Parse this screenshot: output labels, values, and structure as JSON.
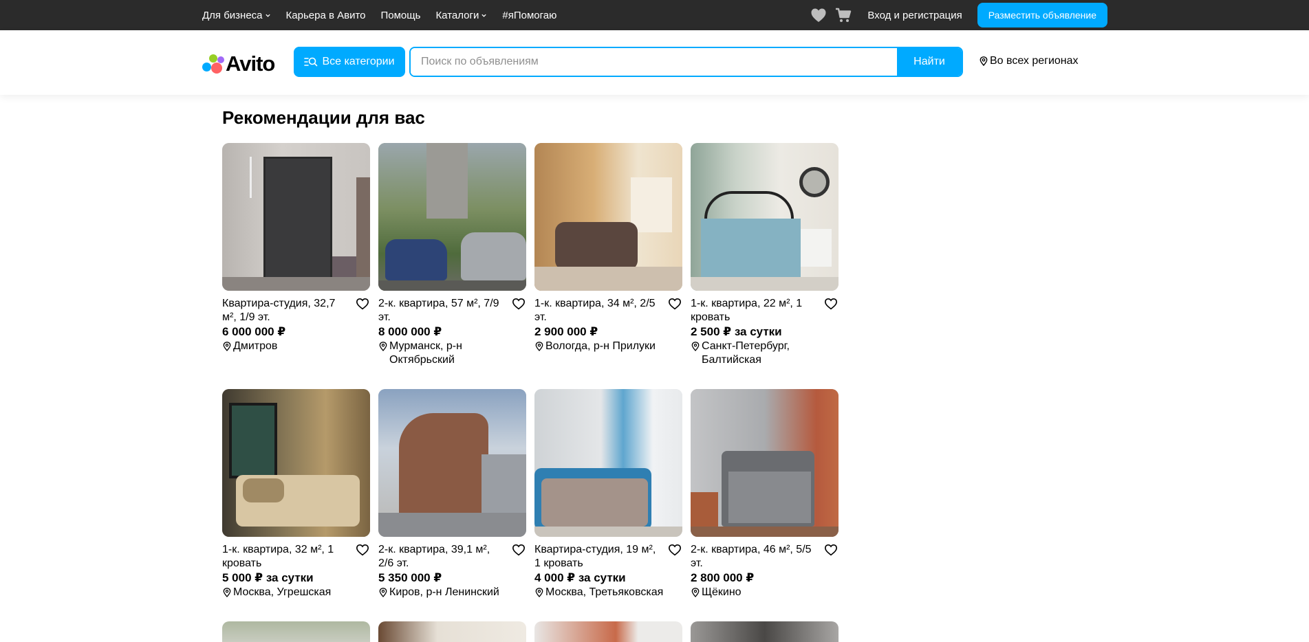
{
  "topbar": {
    "nav": [
      {
        "label": "Для бизнеса",
        "dropdown": true
      },
      {
        "label": "Карьера в Авито",
        "dropdown": false
      },
      {
        "label": "Помощь",
        "dropdown": false
      },
      {
        "label": "Каталоги",
        "dropdown": true
      },
      {
        "label": "#яПомогаю",
        "dropdown": false
      }
    ],
    "login_label": "Вход и регистрация",
    "post_label": "Разместить объявление"
  },
  "header": {
    "logo_text": "Avito",
    "categories_label": "Все категории",
    "search_placeholder": "Поиск по объявлениям",
    "search_button": "Найти",
    "region_label": "Во всех регионах"
  },
  "main": {
    "section_title": "Рекомендации для вас",
    "listings": [
      {
        "title": "Квартира-студия, 32,7 м², 1/9 эт.",
        "price": "6 000 000 ₽",
        "location": "Дмитров"
      },
      {
        "title": "2-к. квартира, 57 м², 7/9 эт.",
        "price": "8 000 000 ₽",
        "location": "Мурманск, р-н Октябрьский"
      },
      {
        "title": "1-к. квартира, 34 м², 2/5 эт.",
        "price": "2 900 000 ₽",
        "location": "Вологда, р-н Прилуки"
      },
      {
        "title": "1-к. квартира, 22 м², 1 кровать",
        "price": "2 500 ₽ за сутки",
        "location": "Санкт-Петербург, Балтийская"
      },
      {
        "title": "1-к. квартира, 32 м², 1 кровать",
        "price": "5 000 ₽ за сутки",
        "location": "Москва, Угрешская"
      },
      {
        "title": "2-к. квартира, 39,1 м², 2/6 эт.",
        "price": "5 350 000 ₽",
        "location": "Киров, р-н Ленинский"
      },
      {
        "title": "Квартира-студия, 19 м², 1 кровать",
        "price": "4 000 ₽ за сутки",
        "location": "Москва, Третьяковская"
      },
      {
        "title": "2-к. квартира, 46 м², 5/5 эт.",
        "price": "2 800 000 ₽",
        "location": "Щёкино"
      }
    ]
  },
  "colors": {
    "accent": "#00aaff",
    "topbar_bg": "#2b2b2b"
  },
  "icons": [
    "chevron-down-icon",
    "heart-icon",
    "cart-icon",
    "search-icon",
    "location-pin-icon"
  ]
}
